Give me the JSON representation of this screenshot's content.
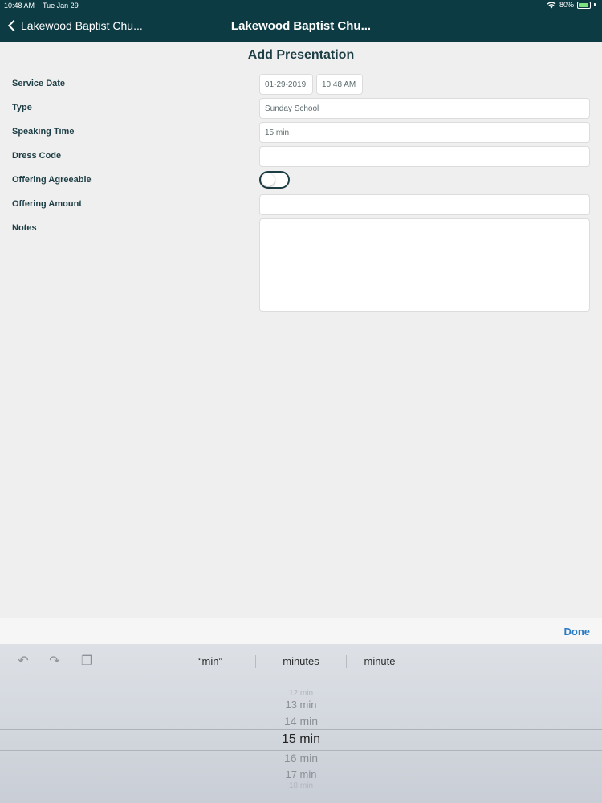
{
  "status_bar": {
    "time": "10:48 AM",
    "date": "Tue Jan 29",
    "battery": "80%",
    "battery_color": "#7ee37e"
  },
  "nav": {
    "back_label": "Lakewood Baptist Chu...",
    "title": "Lakewood Baptist Chu..."
  },
  "page": {
    "title": "Add Presentation"
  },
  "form": {
    "service_date_label": "Service Date",
    "service_date_value": "01-29-2019",
    "service_time_value": "10:48 AM",
    "type_label": "Type",
    "type_value": "Sunday School",
    "speaking_time_label": "Speaking Time",
    "speaking_time_value": "15 min",
    "dress_code_label": "Dress Code",
    "dress_code_value": "",
    "offering_agreeable_label": "Offering Agreeable",
    "offering_agreeable_on": false,
    "offering_amount_label": "Offering Amount",
    "offering_amount_value": "",
    "notes_label": "Notes",
    "notes_value": ""
  },
  "accessory": {
    "done_label": "Done"
  },
  "keyboard": {
    "suggestions": [
      "“min”",
      "minutes",
      "minute"
    ]
  },
  "picker": {
    "items": [
      "12 min",
      "13 min",
      "14 min",
      "15 min",
      "16 min",
      "17 min",
      "18 min"
    ],
    "selected": "15 min"
  },
  "colors": {
    "header": "#0d3b43",
    "accent": "#2b7bc3",
    "text": "#1d3e45"
  }
}
